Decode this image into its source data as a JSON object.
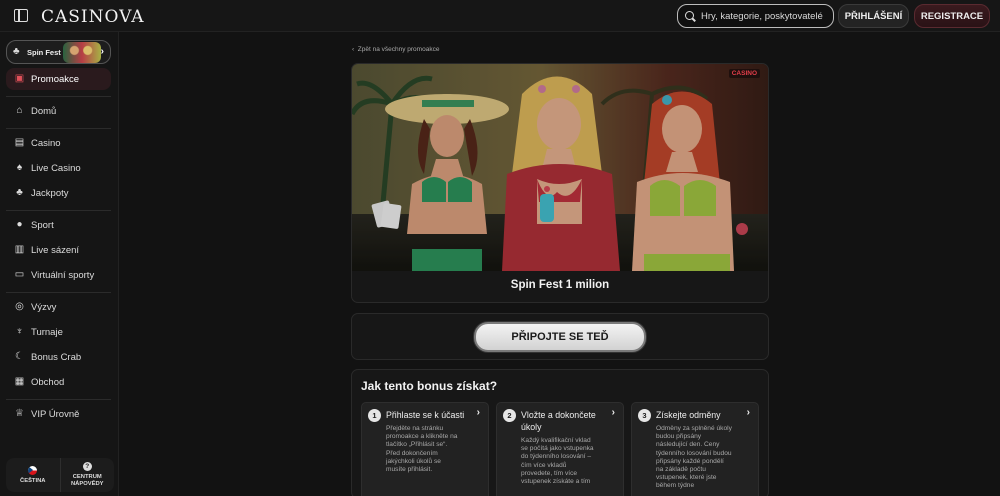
{
  "header": {
    "logo": "CASINOVA",
    "search_placeholder": "Hry, kategorie, poskytovatelé",
    "login_label": "PŘIHLÁŠENÍ",
    "register_label": "REGISTRACE"
  },
  "sidebar": {
    "promo_banner": "Spin Fest",
    "items": [
      {
        "label": "Promoakce",
        "icon": "gift-icon"
      },
      {
        "label": "Domů",
        "icon": "home-icon"
      },
      {
        "label": "Casino",
        "icon": "slot-icon"
      },
      {
        "label": "Live Casino",
        "icon": "dealer-icon"
      },
      {
        "label": "Jackpoty",
        "icon": "clover-icon"
      },
      {
        "label": "Sport",
        "icon": "ball-icon"
      },
      {
        "label": "Live sázení",
        "icon": "live-icon"
      },
      {
        "label": "Virtuální sporty",
        "icon": "vs-icon"
      },
      {
        "label": "Výzvy",
        "icon": "medal-icon"
      },
      {
        "label": "Turnaje",
        "icon": "trophy-icon"
      },
      {
        "label": "Bonus Crab",
        "icon": "crab-icon"
      },
      {
        "label": "Obchod",
        "icon": "shop-icon"
      },
      {
        "label": "VIP Úrovně",
        "icon": "crown-icon"
      }
    ],
    "language_label": "ČEŠTINA",
    "help_label_1": "CENTRUM",
    "help_label_2": "NÁPOVĚDY"
  },
  "main": {
    "back_link": "Zpět na všechny promoakce",
    "badge": "CASINO",
    "promo_title": "Spin Fest 1 milion",
    "join_button": "PŘIPOJTE SE TEĎ",
    "how_title": "Jak tento bonus získat?",
    "steps": [
      {
        "num": "1",
        "title": "Přihlaste se k účasti",
        "text": "Přejděte na stránku promoakce a klikněte na tlačítko „Přihlásit se“. Před dokončením jakýchkoli úkolů se musíte přihlásit."
      },
      {
        "num": "2",
        "title": "Vložte a dokončete úkoly",
        "text": "Každý kvalifikační vklad se počítá jako vstupenka do týdenního losování – čím více vkladů provedete, tím více vstupenek získáte a tím"
      },
      {
        "num": "3",
        "title": "Získejte odměny",
        "text": "Odměny za splněné úkoly budou připsány následující den. Ceny týdenního losování budou připsány každé pondělí na základě počtu vstupenek, které jste během týdne"
      }
    ]
  }
}
